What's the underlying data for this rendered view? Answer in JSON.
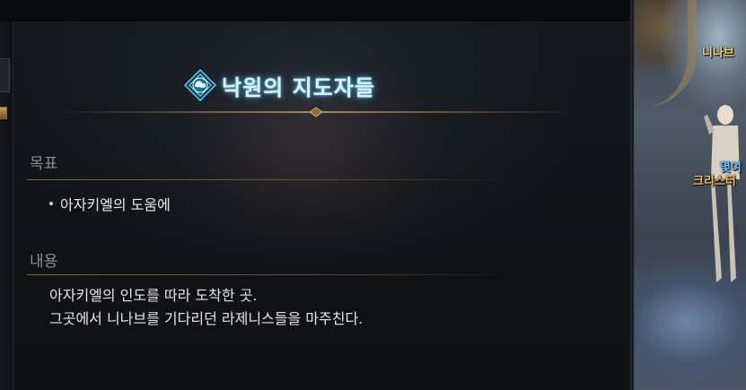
{
  "quest": {
    "title": "낙원의 지도자들",
    "icon": "globe-quest-icon",
    "objective_heading": "목표",
    "objectives": [
      "아자키엘의 도움에"
    ],
    "content_heading": "내용",
    "content_lines": [
      "아자키엘의 인도를 따라 도착한 곳.",
      "그곳에서 니나브를 기다리던 라제니스들을 마주친다."
    ]
  },
  "scene": {
    "npc_label_top": "니나브",
    "npc_label_1": "몇여",
    "npc_label_2": "크리스터"
  },
  "colors": {
    "title_glow": "#5ac8ff",
    "heading": "#8c8f94",
    "divider_gold": "#b09256",
    "body_text": "#e6e6e6"
  }
}
